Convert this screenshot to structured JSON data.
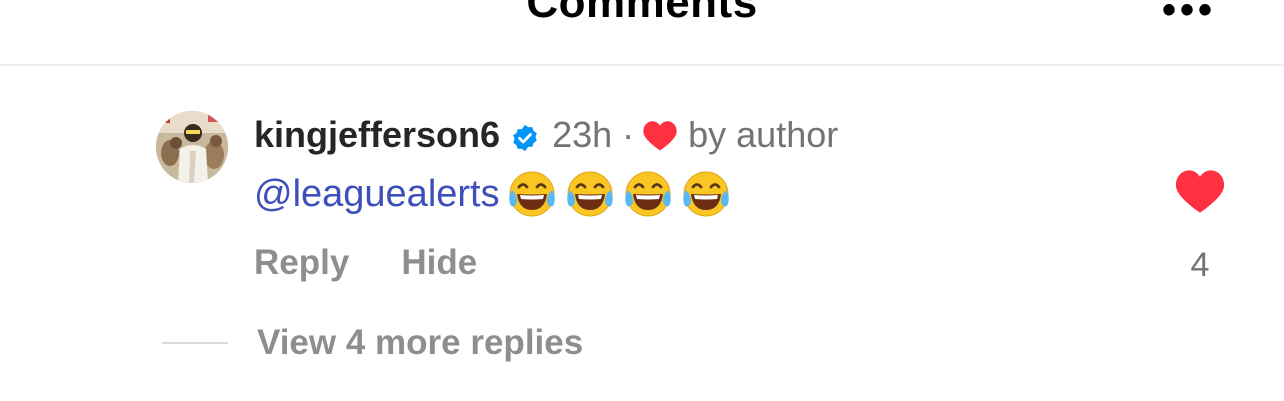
{
  "header": {
    "title": "Comments",
    "more_icon": "ellipsis-icon"
  },
  "comment": {
    "avatar_icon": "user-avatar",
    "username": "kingjefferson6",
    "verified_icon": "verified-badge-icon",
    "time": "23h",
    "separator": "·",
    "author_heart_icon": "heart-icon",
    "liked_by": "by author",
    "mention": "@leaguealerts",
    "emojis": [
      "face-with-tears-of-joy",
      "face-with-tears-of-joy",
      "face-with-tears-of-joy",
      "face-with-tears-of-joy"
    ],
    "actions": {
      "reply": "Reply",
      "hide": "Hide"
    },
    "like_icon": "heart-filled-icon",
    "like_count": "4",
    "view_replies": "View 4 more replies"
  },
  "colors": {
    "heart": "#ff3040",
    "mention": "#3d4fb8",
    "verified": "#0095f6",
    "muted_text": "#8e8e8e",
    "username": "#262626"
  }
}
